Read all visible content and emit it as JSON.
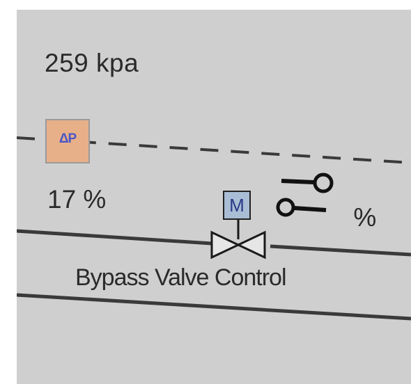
{
  "pressure": {
    "text": "259 kpa"
  },
  "dp_transmitter": {
    "label": "ΔP",
    "percent_text": "17 %"
  },
  "bypass_valve": {
    "motor_label": "M",
    "percent_text": "     %",
    "caption": "Bypass Valve Control"
  },
  "colors": {
    "screen_background": "#cfcfcf",
    "dp_box": "#e8b089",
    "dp_text": "#4a56c8",
    "motor_box": "#a9bdd4",
    "pipe": "#3a3a3a"
  },
  "icons": [
    "delta-p-icon",
    "motor-icon",
    "gate-valve-icon",
    "manual-mode-icon",
    "auto-mode-icon"
  ]
}
